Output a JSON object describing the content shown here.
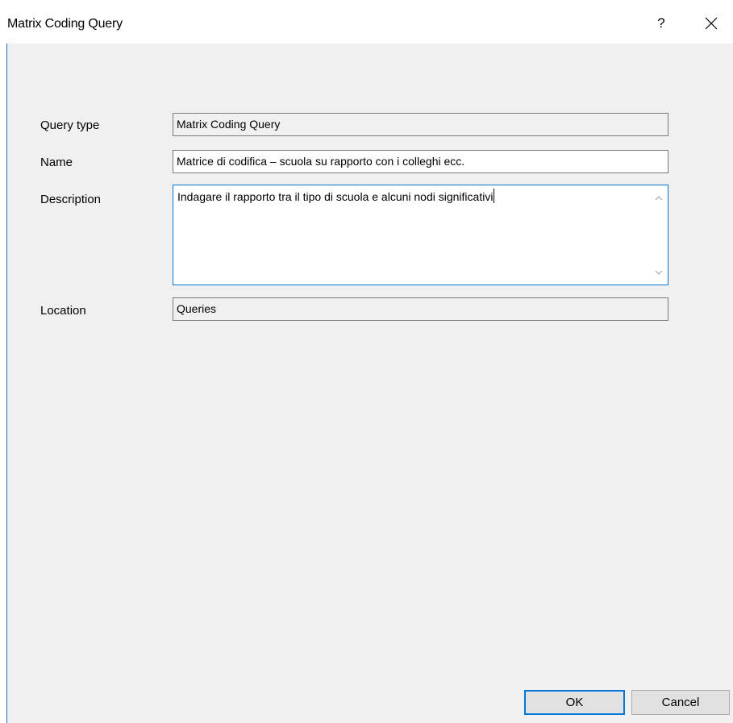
{
  "window": {
    "title": "Matrix Coding Query",
    "help_label": "?",
    "close_icon": "close-icon"
  },
  "form": {
    "query_type": {
      "label": "Query type",
      "value": "Matrix Coding Query"
    },
    "name": {
      "label": "Name",
      "value": "Matrice di codifica – scuola su rapporto con i colleghi ecc."
    },
    "description": {
      "label": "Description",
      "value": "Indagare il rapporto tra il tipo di scuola e alcuni nodi significativi"
    },
    "location": {
      "label": "Location",
      "value": "Queries"
    }
  },
  "buttons": {
    "ok_label": "OK",
    "cancel_label": "Cancel"
  },
  "colors": {
    "accent": "#0078d7",
    "background": "#f0f0f0"
  }
}
